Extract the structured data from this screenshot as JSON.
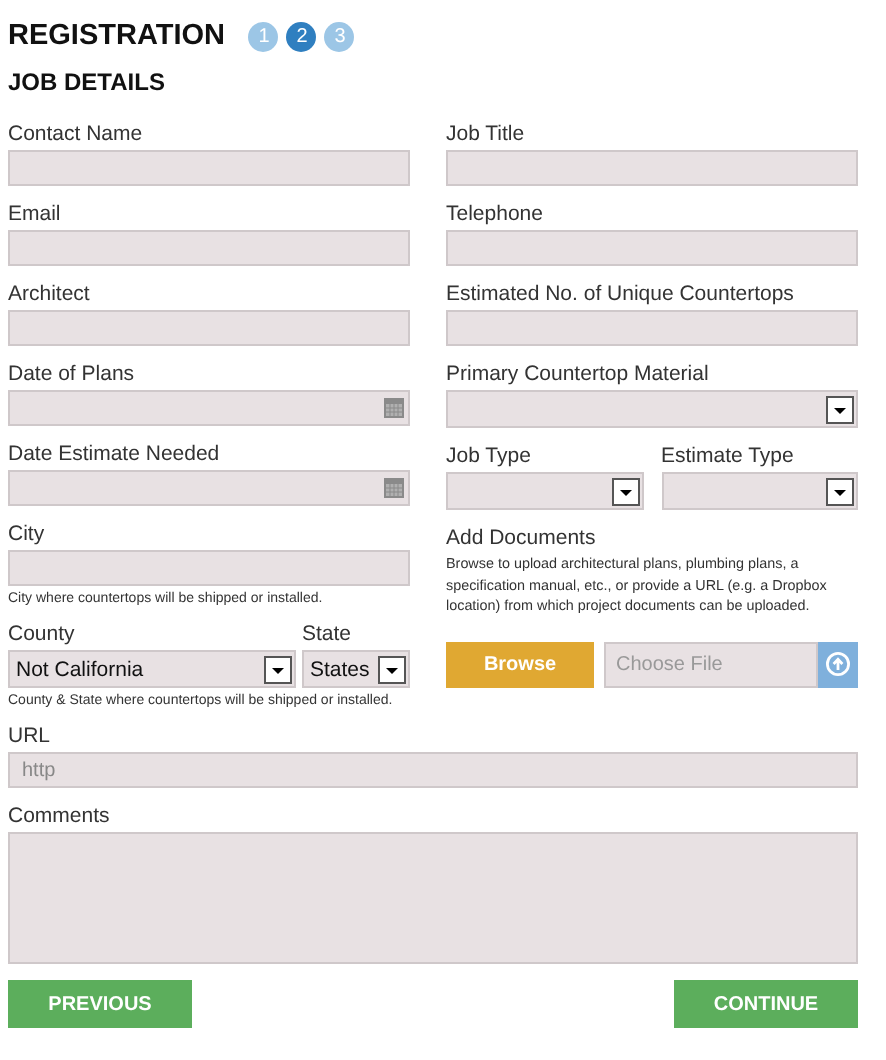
{
  "header": {
    "title": "REGISTRATION",
    "steps": [
      {
        "label": "1",
        "selected": false
      },
      {
        "label": "2",
        "selected": true
      },
      {
        "label": "3",
        "selected": false
      }
    ]
  },
  "section_title": "JOB DETAILS",
  "left_fields": [
    {
      "kind": "text",
      "label": "Contact Name"
    },
    {
      "kind": "text",
      "label": "Email"
    },
    {
      "kind": "text",
      "label": "Architect"
    },
    {
      "kind": "date",
      "label": "Date of Plans"
    },
    {
      "kind": "date",
      "label": "Date Estimate Needed"
    },
    {
      "kind": "text",
      "label": "City",
      "help": "City where countertops will be shipped or installed."
    },
    {
      "kind": "select_pair_wide",
      "selects": [
        {
          "label": "County",
          "value": "Not California"
        },
        {
          "label": "State",
          "value": "States"
        }
      ],
      "help": "County & State where countertops will be shipped or installed."
    }
  ],
  "right_fields": [
    {
      "kind": "text",
      "label": "Job Title"
    },
    {
      "kind": "text",
      "label": "Telephone"
    },
    {
      "kind": "text",
      "label": "Estimated No. of Unique Countertops"
    },
    {
      "kind": "select",
      "label": "Primary Countertop Material"
    },
    {
      "kind": "select_pair",
      "selects": [
        {
          "label": "Job Type"
        },
        {
          "label": "Estimate Type"
        }
      ]
    },
    {
      "kind": "upload",
      "label": "Add Documents",
      "description": "Browse to upload architectural plans, plumbing plans, a specification manual, etc., or provide a URL (e.g. a Dropbox location) from which project documents can be uploaded.",
      "button": "Browse",
      "placeholder": "Choose File"
    }
  ],
  "url": {
    "label": "URL",
    "placeholder": "http"
  },
  "comments": {
    "label": "Comments"
  },
  "buttons": {
    "previous": "PREVIOUS",
    "continue": "CONTINUE"
  }
}
